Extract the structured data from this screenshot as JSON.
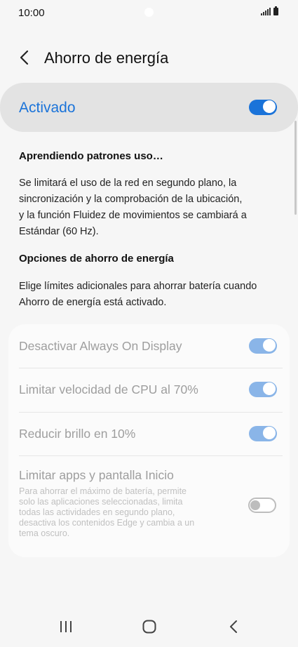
{
  "status": {
    "time": "10:00"
  },
  "header": {
    "title": "Ahorro de energía"
  },
  "master": {
    "label": "Activado",
    "on": true
  },
  "learning": {
    "heading": "Aprendiendo patrones uso…",
    "lines": [
      "Se limitará el uso de la red en segundo plano, la",
      "sincronización y la comprobación de la ubicación,",
      "y la función Fluidez de movimientos se cambiará a",
      "Estándar (60 Hz)."
    ]
  },
  "options": {
    "heading": "Opciones de ahorro de energía",
    "lines": [
      "Elige límites adicionales para ahorrar batería cuando",
      "Ahorro de energía está activado."
    ]
  },
  "settings": [
    {
      "label": "Desactivar Always On Display",
      "on": true
    },
    {
      "label": "Limitar velocidad de CPU al 70%",
      "on": true
    },
    {
      "label": "Reducir brillo en 10%",
      "on": true
    },
    {
      "label": "Limitar apps y pantalla Inicio",
      "on": false,
      "desc_lines": [
        "Para ahorrar el máximo de batería, permite",
        "solo las aplicaciones seleccionadas, limita",
        "todas las actividades en segundo plano,",
        "desactiva los contenidos Edge y cambia a un",
        "tema oscuro."
      ]
    }
  ],
  "colors": {
    "accent": "#1a73d9",
    "accent_dim": "#8ab5e8",
    "background": "#f6f6f6"
  },
  "icons": {
    "back": "chevron-left-icon",
    "recents": "recent-apps-icon",
    "home": "home-icon",
    "nav_back": "nav-back-icon"
  }
}
